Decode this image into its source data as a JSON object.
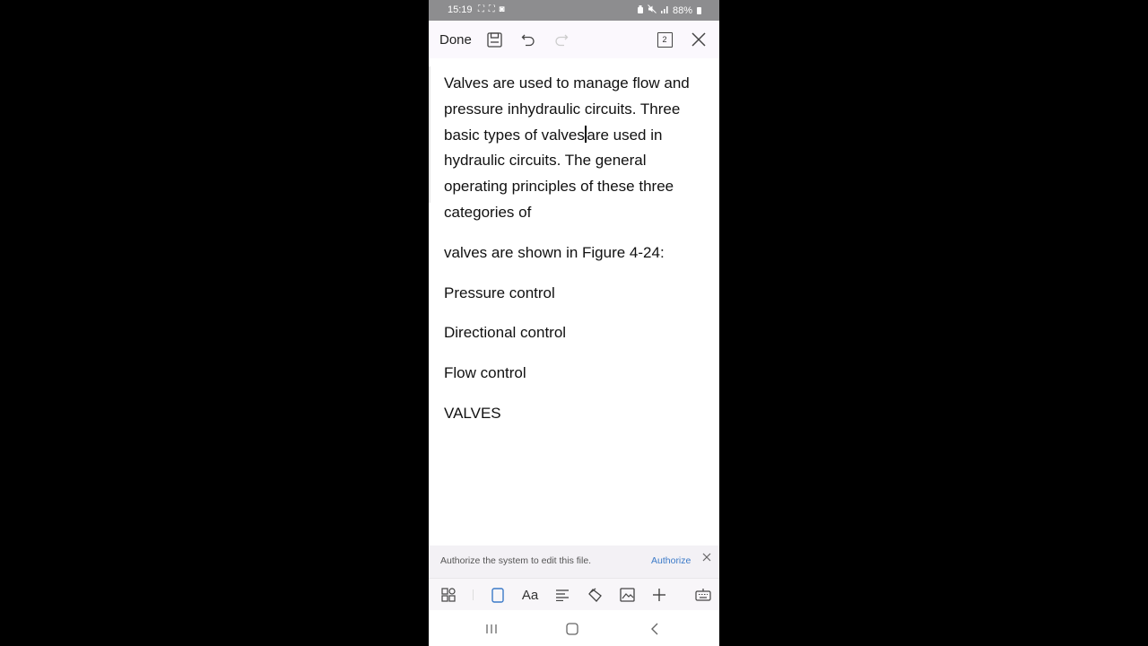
{
  "status_bar": {
    "time": "15:19",
    "notif_icons": "⛶ ⛶ ◙",
    "battery_pct": "88%"
  },
  "toolbar": {
    "done_label": "Done",
    "page_count": "2"
  },
  "document": {
    "paragraph1_before_caret": "Valves are used to manage flow and pressure inhydraulic circuits. Three basic types of valves",
    "paragraph1_after_caret": "are used in hydraulic circuits. The general operating principles of these three categories of",
    "paragraph2": "valves are shown in Figure 4-24:",
    "item1": "Pressure control",
    "item2": "Directional control",
    "item3": "Flow control",
    "heading": "VALVES"
  },
  "auth_bar": {
    "message": "Authorize the system to edit this file.",
    "action_label": "Authorize"
  },
  "colors": {
    "accent": "#3b7ac8",
    "status_bar_bg": "#8d8d8f"
  }
}
